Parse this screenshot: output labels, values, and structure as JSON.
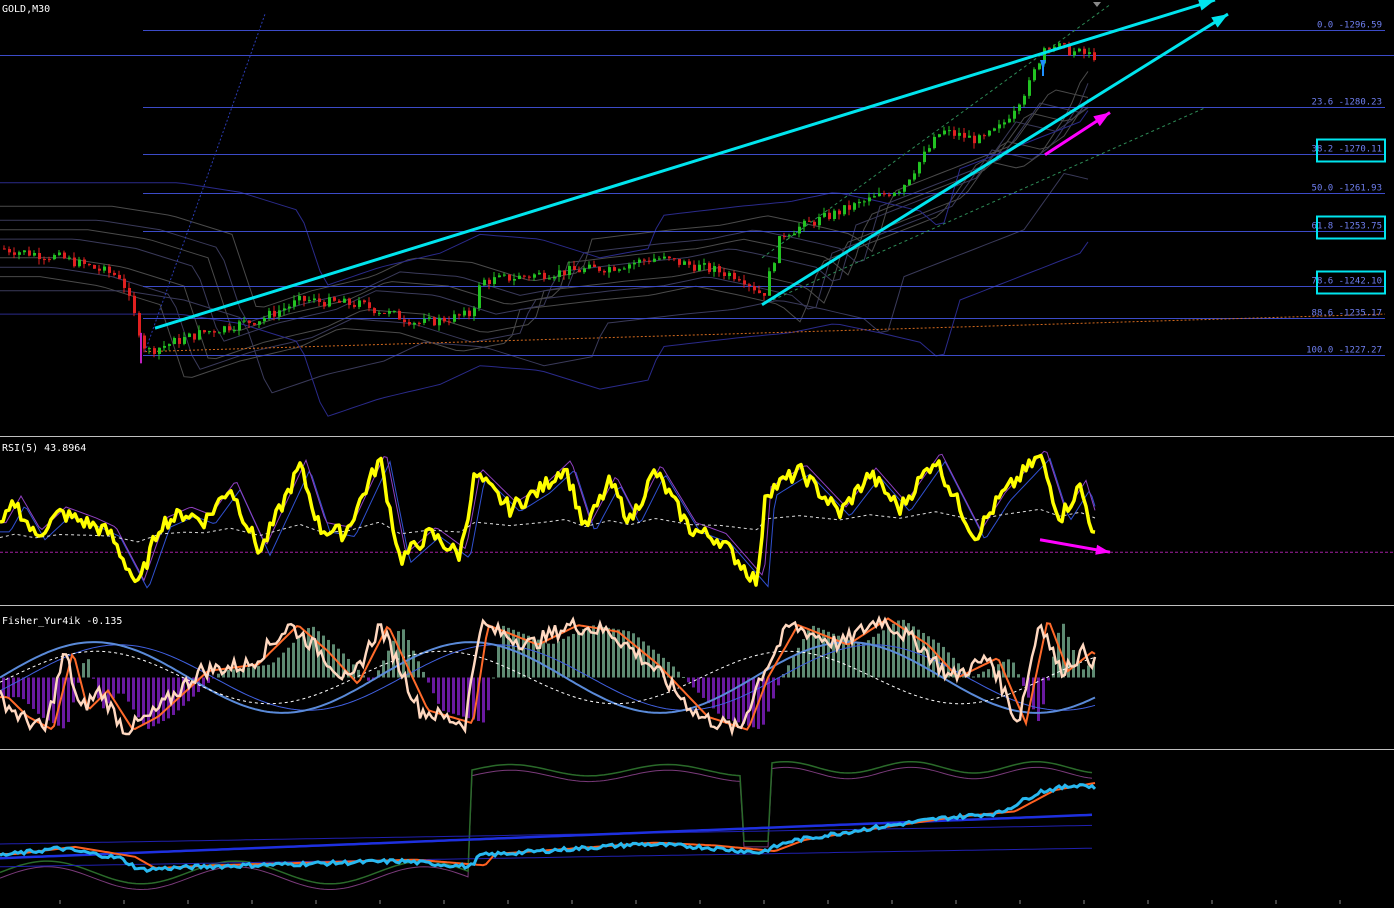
{
  "chart_data": [
    {
      "type": "candlestick",
      "title": "GOLD,M30",
      "ylim": [
        1210,
        1303
      ],
      "fib_levels": [
        {
          "label": "0.0 -1296.59",
          "pct": 0.0,
          "price": 1296.59,
          "boxed": false
        },
        {
          "label": "23.6 -1280.23",
          "pct": 23.6,
          "price": 1280.23,
          "boxed": false
        },
        {
          "label": "38.2 -1270.11",
          "pct": 38.2,
          "price": 1270.11,
          "boxed": true
        },
        {
          "label": "50.0 -1261.93",
          "pct": 50.0,
          "price": 1261.93,
          "boxed": false
        },
        {
          "label": "61.8 -1253.75",
          "pct": 61.8,
          "price": 1253.75,
          "boxed": true
        },
        {
          "label": "78.6 -1242.10",
          "pct": 78.6,
          "price": 1242.1,
          "boxed": true
        },
        {
          "label": "88.6 -1235.17",
          "pct": 88.6,
          "price": 1235.17,
          "boxed": false
        },
        {
          "label": "100.0 -1227.27",
          "pct": 100.0,
          "price": 1227.27,
          "boxed": false
        }
      ],
      "current_price": 1291.2,
      "price_path": [
        [
          0,
          1250
        ],
        [
          60,
          1248
        ],
        [
          120,
          1244
        ],
        [
          145,
          1228
        ],
        [
          200,
          1232
        ],
        [
          260,
          1235
        ],
        [
          300,
          1239
        ],
        [
          360,
          1238
        ],
        [
          420,
          1234
        ],
        [
          470,
          1236
        ],
        [
          480,
          1243
        ],
        [
          560,
          1245
        ],
        [
          610,
          1246
        ],
        [
          655,
          1248
        ],
        [
          700,
          1246
        ],
        [
          740,
          1244
        ],
        [
          762,
          1240
        ],
        [
          780,
          1253
        ],
        [
          840,
          1258
        ],
        [
          900,
          1263
        ],
        [
          940,
          1275
        ],
        [
          980,
          1273
        ],
        [
          1000,
          1276
        ],
        [
          1028,
          1285
        ],
        [
          1045,
          1294
        ],
        [
          1070,
          1292
        ],
        [
          1095,
          1291
        ]
      ],
      "series": [
        {
          "name": "channel-upper",
          "color": "#00E5EE",
          "from": [
            155,
            1233
          ],
          "to": [
            1215,
            1303
          ]
        },
        {
          "name": "channel-lower",
          "color": "#00E5EE",
          "from": [
            762,
            1238
          ],
          "to": [
            1228,
            1300
          ]
        },
        {
          "name": "momentum-arrow",
          "color": "#FF00FF",
          "from": [
            1045,
            1270
          ],
          "to": [
            1110,
            1279
          ]
        }
      ]
    },
    {
      "type": "line",
      "title": "RSI(5) 43.8964",
      "ylim": [
        0,
        100
      ],
      "level": 30,
      "path": [
        [
          0,
          45
        ],
        [
          15,
          62
        ],
        [
          35,
          40
        ],
        [
          60,
          55
        ],
        [
          90,
          48
        ],
        [
          110,
          42
        ],
        [
          138,
          8
        ],
        [
          160,
          48
        ],
        [
          185,
          55
        ],
        [
          205,
          50
        ],
        [
          230,
          72
        ],
        [
          260,
          30
        ],
        [
          300,
          85
        ],
        [
          320,
          45
        ],
        [
          345,
          42
        ],
        [
          380,
          90
        ],
        [
          400,
          25
        ],
        [
          430,
          42
        ],
        [
          460,
          28
        ],
        [
          475,
          80
        ],
        [
          510,
          58
        ],
        [
          540,
          70
        ],
        [
          565,
          85
        ],
        [
          585,
          45
        ],
        [
          610,
          75
        ],
        [
          630,
          50
        ],
        [
          655,
          82
        ],
        [
          690,
          45
        ],
        [
          720,
          38
        ],
        [
          758,
          10
        ],
        [
          765,
          68
        ],
        [
          800,
          82
        ],
        [
          840,
          55
        ],
        [
          870,
          80
        ],
        [
          900,
          58
        ],
        [
          935,
          90
        ],
        [
          975,
          40
        ],
        [
          1000,
          65
        ],
        [
          1040,
          92
        ],
        [
          1060,
          52
        ],
        [
          1080,
          72
        ],
        [
          1095,
          40
        ]
      ],
      "arrow": {
        "color": "#FF00FF",
        "from": [
          1040,
          38
        ],
        "to": [
          1110,
          30
        ]
      }
    },
    {
      "type": "bar",
      "title": "Fisher_Yur4ik -0.135",
      "ylim": [
        -1,
        1
      ],
      "path": [
        [
          0,
          -0.3
        ],
        [
          20,
          -0.6
        ],
        [
          45,
          -0.8
        ],
        [
          65,
          0.4
        ],
        [
          80,
          -0.5
        ],
        [
          100,
          -0.2
        ],
        [
          125,
          -0.8
        ],
        [
          150,
          -0.6
        ],
        [
          200,
          0.1
        ],
        [
          250,
          0.2
        ],
        [
          290,
          0.8
        ],
        [
          320,
          0.4
        ],
        [
          350,
          -0.1
        ],
        [
          380,
          0.8
        ],
        [
          420,
          -0.5
        ],
        [
          465,
          -0.7
        ],
        [
          480,
          0.8
        ],
        [
          530,
          0.5
        ],
        [
          570,
          0.8
        ],
        [
          610,
          0.7
        ],
        [
          650,
          0.2
        ],
        [
          700,
          -0.6
        ],
        [
          740,
          -0.8
        ],
        [
          760,
          0.0
        ],
        [
          790,
          0.8
        ],
        [
          840,
          0.5
        ],
        [
          880,
          0.9
        ],
        [
          920,
          0.5
        ],
        [
          950,
          0.0
        ],
        [
          990,
          0.3
        ],
        [
          1018,
          -0.7
        ],
        [
          1040,
          0.9
        ],
        [
          1060,
          0.1
        ],
        [
          1085,
          0.4
        ],
        [
          1095,
          0.2
        ]
      ]
    },
    {
      "type": "line",
      "title": "",
      "ylim": [
        0,
        100
      ],
      "path": [
        [
          0,
          30
        ],
        [
          60,
          35
        ],
        [
          120,
          28
        ],
        [
          140,
          20
        ],
        [
          200,
          22
        ],
        [
          300,
          24
        ],
        [
          400,
          26
        ],
        [
          470,
          22
        ],
        [
          480,
          30
        ],
        [
          560,
          34
        ],
        [
          640,
          38
        ],
        [
          700,
          36
        ],
        [
          760,
          32
        ],
        [
          790,
          40
        ],
        [
          860,
          48
        ],
        [
          940,
          56
        ],
        [
          1000,
          60
        ],
        [
          1040,
          75
        ],
        [
          1080,
          80
        ],
        [
          1095,
          78
        ]
      ]
    }
  ]
}
